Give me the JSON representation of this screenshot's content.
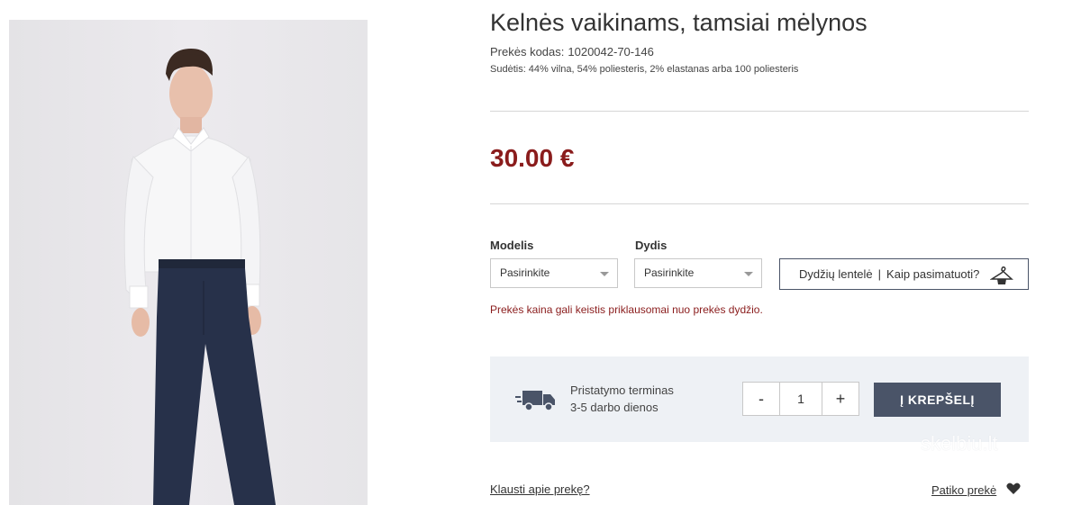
{
  "product": {
    "title": "Kelnės vaikinams, tamsiai mėlynos",
    "sku_label": "Prekės kodas:",
    "sku": "1020042-70-146",
    "composition": "Sudėtis: 44% vilna, 54% poliesteris, 2% elastanas arba 100 poliesteris",
    "price": "30.00 €"
  },
  "options": {
    "model_label": "Modelis",
    "model_value": "Pasirinkite",
    "size_label": "Dydis",
    "size_value": "Pasirinkite",
    "size_table_link": "Dydžių lentelė",
    "separator": "|",
    "how_to_fit_link": "Kaip pasimatuoti?",
    "hanger_icon": "hanger-icon",
    "price_notice": "Prekės kaina gali keistis priklausomai nuo prekės dydžio."
  },
  "delivery": {
    "icon": "truck-icon",
    "title": "Pristatymo terminas",
    "days": "3-5 darbo dienos"
  },
  "cart": {
    "minus": "-",
    "quantity": "1",
    "plus": "+",
    "add_label": "Į KREPŠELĮ"
  },
  "footer": {
    "ask_link": "Klausti apie prekę?",
    "like_link": "Patiko prekė",
    "heart_icon": "heart-icon"
  },
  "watermark": "skelbiu.lt",
  "colors": {
    "price": "#8a1c1c",
    "accent": "#4a5468",
    "panel": "#eef1f5"
  }
}
